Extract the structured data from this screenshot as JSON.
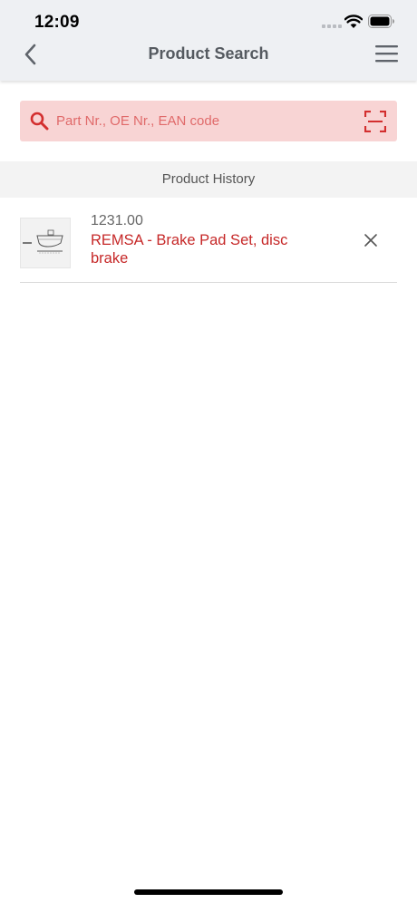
{
  "status_bar": {
    "time": "12:09"
  },
  "nav": {
    "title": "Product Search"
  },
  "search": {
    "placeholder": "Part Nr., OE Nr., EAN code",
    "value": ""
  },
  "history": {
    "heading": "Product History",
    "items": [
      {
        "number": "1231.00",
        "name": "REMSA - Brake Pad Set, disc brake"
      }
    ]
  },
  "icons": {
    "back": "chevron-left-icon",
    "menu": "hamburger-menu-icon",
    "search": "search-icon",
    "scan": "barcode-scan-icon",
    "remove": "close-icon"
  },
  "colors": {
    "accent": "#c62828",
    "search_bg": "#f8d4d4",
    "header_bg": "#eef0f3",
    "section_bg": "#f3f3f3"
  }
}
